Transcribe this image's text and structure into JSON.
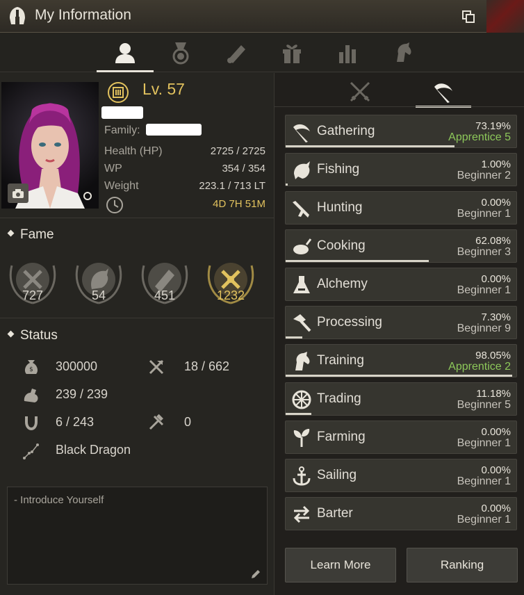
{
  "window": {
    "title": "My Information",
    "icon": "helmet-icon"
  },
  "top_tabs": [
    {
      "name": "tab-character",
      "icon": "person-icon",
      "active": true
    },
    {
      "name": "tab-medals",
      "icon": "medal-icon",
      "active": false
    },
    {
      "name": "tab-knowledge",
      "icon": "scroll-icon",
      "active": false
    },
    {
      "name": "tab-pets",
      "icon": "paw-icon",
      "active": false
    },
    {
      "name": "tab-gifts",
      "icon": "gift-icon",
      "active": false
    },
    {
      "name": "tab-stats",
      "icon": "bar-chart-icon",
      "active": false
    },
    {
      "name": "tab-mount",
      "icon": "horse-icon",
      "active": false
    }
  ],
  "character": {
    "level": "Lv. 57",
    "family_label": "Family:",
    "stats": [
      {
        "label": "Health (HP)",
        "value": "2725 / 2725"
      },
      {
        "label": "WP",
        "value": "354 / 354"
      },
      {
        "label": "Weight",
        "value": "223.1 / 713 LT"
      }
    ],
    "timer": "4D 7H 51M"
  },
  "fame": {
    "heading": "Fame",
    "items": [
      {
        "icon": "crossed-swords-icon",
        "value": "727"
      },
      {
        "icon": "fish-hook-icon",
        "value": "54"
      },
      {
        "icon": "scroll-icon",
        "value": "451"
      },
      {
        "icon": "crossed-axes-icon",
        "value": "1232",
        "highlight": true
      }
    ]
  },
  "status": {
    "heading": "Status",
    "left": [
      {
        "icon": "coin-bag-icon",
        "value": "300000"
      },
      {
        "icon": "muscle-icon",
        "value": "239 / 239"
      },
      {
        "icon": "horseshoe-icon",
        "value": "6 / 243"
      },
      {
        "icon": "constellation-icon",
        "value": "Black Dragon"
      }
    ],
    "right": [
      {
        "icon": "axe-icon",
        "value": "18 / 662"
      },
      {
        "icon": "tools-icon",
        "value": "0"
      }
    ]
  },
  "intro": {
    "placeholder": "- Introduce Yourself"
  },
  "right_tabs": [
    {
      "icon": "crossed-swords-icon",
      "active": false
    },
    {
      "icon": "sickle-icon",
      "active": true
    }
  ],
  "skills": [
    {
      "name": "Gathering",
      "percent": "73.19%",
      "rank": "Apprentice 5",
      "green": true,
      "progress": 0.7319,
      "icon": "sickle-icon"
    },
    {
      "name": "Fishing",
      "percent": "1.00%",
      "rank": "Beginner 2",
      "green": false,
      "progress": 0.01,
      "icon": "fish-icon"
    },
    {
      "name": "Hunting",
      "percent": "0.00%",
      "rank": "Beginner 1",
      "green": false,
      "progress": 0.0,
      "icon": "rifle-icon"
    },
    {
      "name": "Cooking",
      "percent": "62.08%",
      "rank": "Beginner 3",
      "green": false,
      "progress": 0.6208,
      "icon": "roast-icon"
    },
    {
      "name": "Alchemy",
      "percent": "0.00%",
      "rank": "Beginner 1",
      "green": false,
      "progress": 0.0,
      "icon": "flask-icon"
    },
    {
      "name": "Processing",
      "percent": "7.30%",
      "rank": "Beginner 9",
      "green": false,
      "progress": 0.073,
      "icon": "hammer-icon"
    },
    {
      "name": "Training",
      "percent": "98.05%",
      "rank": "Apprentice 2",
      "green": true,
      "progress": 0.9805,
      "icon": "horse-head-icon"
    },
    {
      "name": "Trading",
      "percent": "11.18%",
      "rank": "Beginner 5",
      "green": false,
      "progress": 0.1118,
      "icon": "wheel-icon"
    },
    {
      "name": "Farming",
      "percent": "0.00%",
      "rank": "Beginner 1",
      "green": false,
      "progress": 0.0,
      "icon": "sprout-icon"
    },
    {
      "name": "Sailing",
      "percent": "0.00%",
      "rank": "Beginner 1",
      "green": false,
      "progress": 0.0,
      "icon": "anchor-icon"
    },
    {
      "name": "Barter",
      "percent": "0.00%",
      "rank": "Beginner 1",
      "green": false,
      "progress": 0.0,
      "icon": "swap-arrows-icon"
    }
  ],
  "buttons": {
    "learn_more": "Learn More",
    "ranking": "Ranking"
  },
  "colors": {
    "gold": "#e2c25e",
    "green": "#8dc85a",
    "panel": "#24231f"
  }
}
